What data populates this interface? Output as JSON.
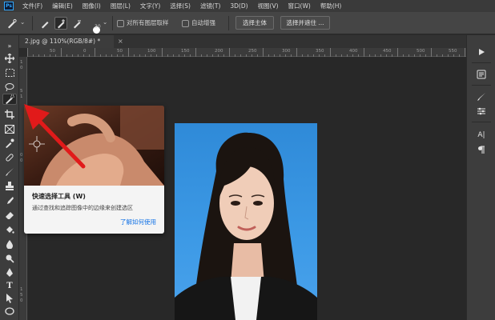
{
  "menu": {
    "logo": "Ps",
    "items": [
      "文件(F)",
      "编辑(E)",
      "图像(I)",
      "图层(L)",
      "文字(Y)",
      "选择(S)",
      "滤镜(T)",
      "3D(D)",
      "视图(V)",
      "窗口(W)",
      "帮助(H)"
    ]
  },
  "options": {
    "brush_size": "30",
    "sample_all_layers": "对所有图层取样",
    "auto_enhance": "自动增强",
    "select_subject": "选择主体",
    "select_and_mask": "选择并遮住 ..."
  },
  "document": {
    "tab_title": "2.jpg @ 110%(RGB/8#) *",
    "close_glyph": "×"
  },
  "rulers": {
    "top": [
      "50",
      "0",
      "50",
      "100",
      "150",
      "200",
      "250",
      "300",
      "350",
      "400",
      "450",
      "500",
      "550"
    ],
    "left": [
      "1",
      "0",
      "5",
      "1",
      "0",
      "0",
      "1",
      "5",
      "0"
    ]
  },
  "tooltip": {
    "title": "快速选择工具 (W)",
    "description": "通过查找和追踪图像中的边缘来创建选区",
    "link": "了解如何使用"
  },
  "right_panel": {
    "text_icon": "A|"
  },
  "colors": {
    "accent": "#31a8ff",
    "photo_background": "#3d9ae6",
    "arrow": "#e11a1a",
    "link": "#1473e6"
  }
}
